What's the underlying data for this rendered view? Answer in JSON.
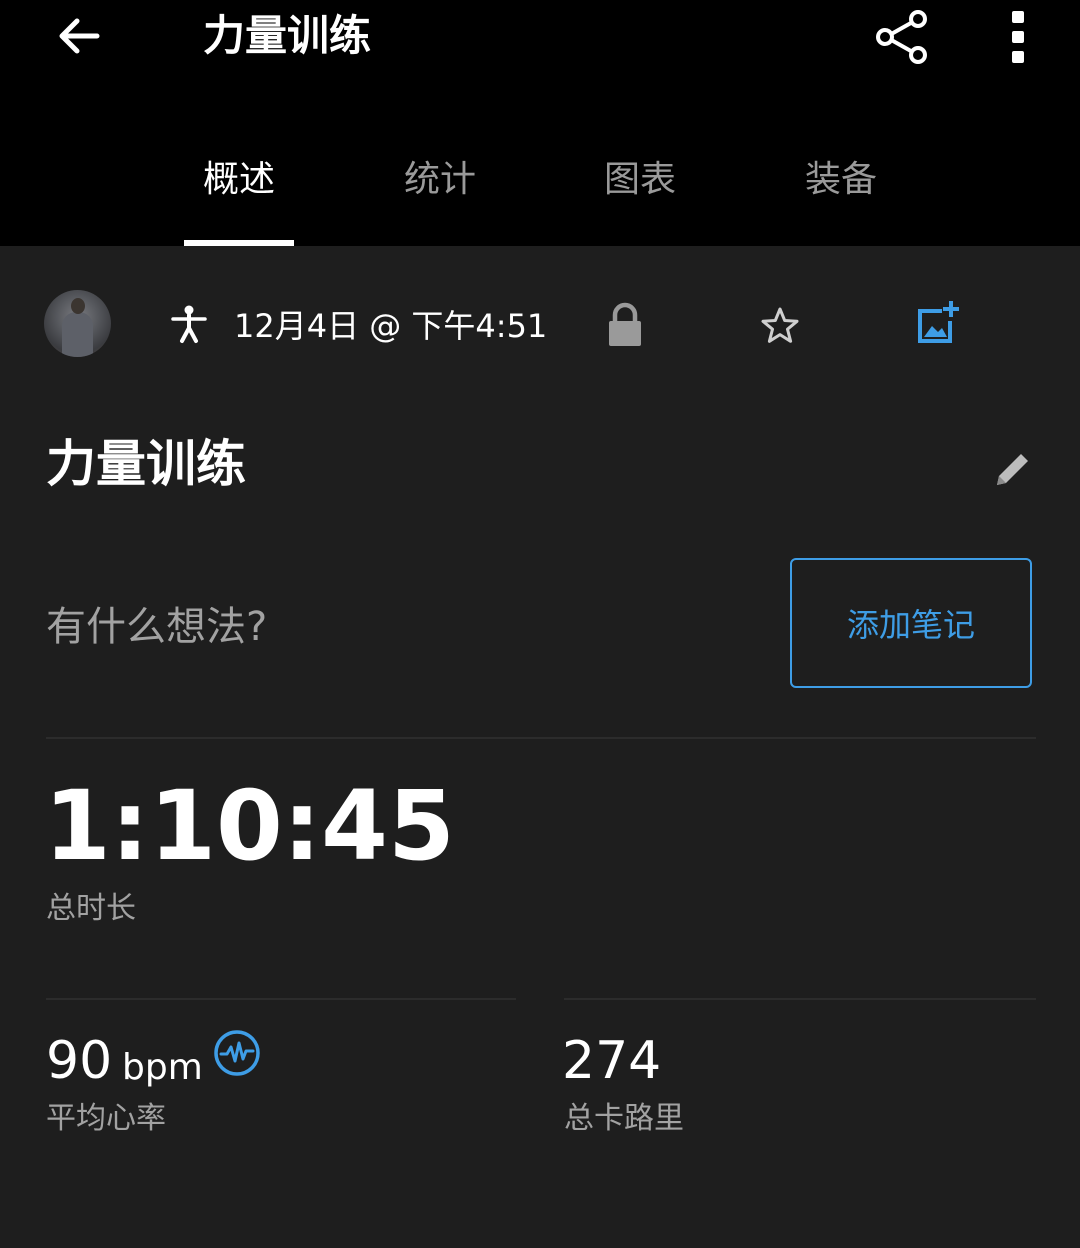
{
  "header": {
    "title": "力量训练",
    "tabs": [
      {
        "label": "概述",
        "active": true
      },
      {
        "label": "统计",
        "active": false
      },
      {
        "label": "图表",
        "active": false
      },
      {
        "label": "装备",
        "active": false
      }
    ],
    "icons": {
      "back": "arrow-back-icon",
      "share": "share-icon",
      "more": "more-vertical-icon"
    }
  },
  "meta": {
    "activity_icon": "strength-training-icon",
    "date": "12月4日 @ 下午4:51",
    "icons": {
      "lock": "lock-icon",
      "star": "star-icon",
      "add_photo": "add-photo-icon"
    }
  },
  "activity": {
    "title": "力量训练",
    "edit_icon": "pencil-icon",
    "thoughts_prompt": "有什么想法?",
    "add_note_label": "添加笔记"
  },
  "stats": {
    "duration": {
      "value": "1:10:45",
      "label": "总时长"
    },
    "heart_rate": {
      "value": "90",
      "unit": "bpm",
      "label": "平均心率",
      "icon": "heart-rate-icon"
    },
    "calories": {
      "value": "274",
      "label": "总卡路里"
    }
  },
  "colors": {
    "header_bg": "#000000",
    "page_bg": "#1e1e1e",
    "accent_blue": "#3e9de6",
    "secondary_text": "#a2a2a2",
    "inactive_tab": "#9a9a9a"
  }
}
